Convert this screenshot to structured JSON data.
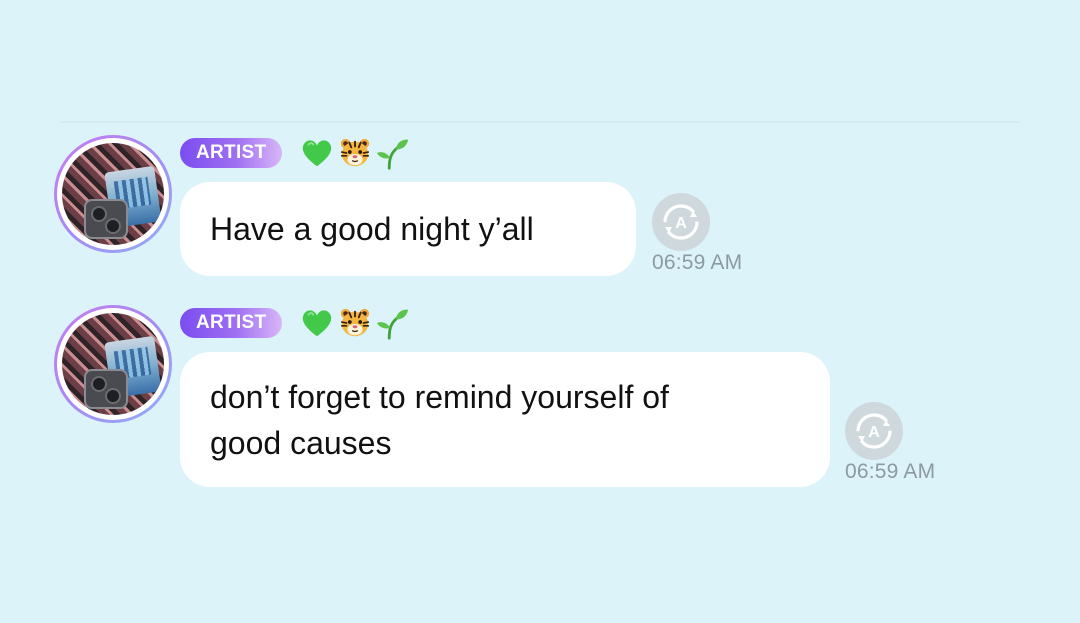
{
  "messages": [
    {
      "role_label": "ARTIST",
      "emojis": [
        "green-heart-icon",
        "tiger-face-icon",
        "seedling-icon"
      ],
      "text": "Have a good night y’all",
      "time": "06:59 AM",
      "translate_icon": "translate-icon"
    },
    {
      "role_label": "ARTIST",
      "emojis": [
        "green-heart-icon",
        "tiger-face-icon",
        "seedling-icon"
      ],
      "text": "don’t forget to remind yourself of\ngood causes",
      "time": "06:59 AM",
      "translate_icon": "translate-icon"
    }
  ],
  "colors": {
    "background": "#dcf3f9",
    "badge_start": "#7a4df0",
    "badge_end": "#d8b6f7",
    "bubble": "#ffffff",
    "timestamp": "#8d9aa2",
    "translate_button": "#cfd8dc"
  }
}
